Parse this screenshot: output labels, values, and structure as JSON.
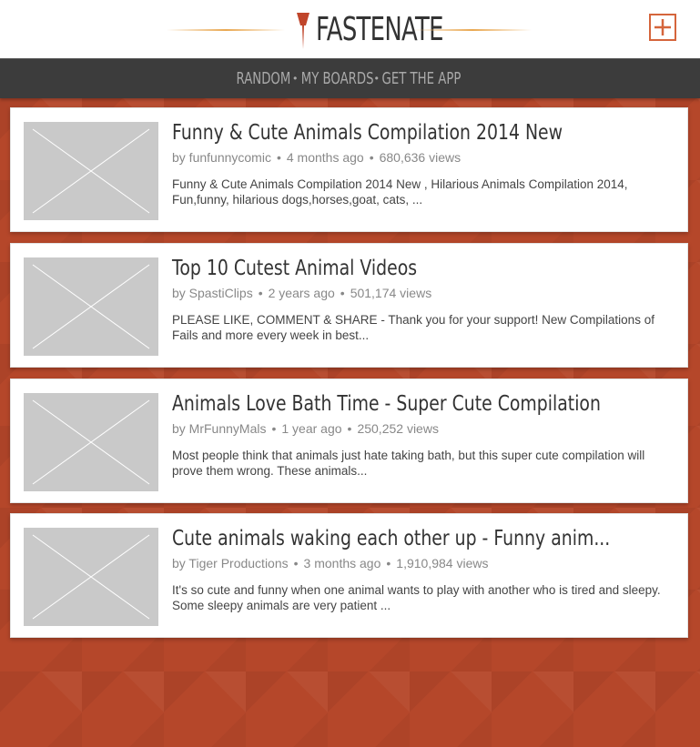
{
  "header": {
    "logo_text": "FASTENATE",
    "accent_color": "#d5653c",
    "line_color": "#e9a852"
  },
  "nav": {
    "items": [
      {
        "label": "RANDOM"
      },
      {
        "label": "MY BOARDS"
      },
      {
        "label": "GET THE APP"
      }
    ],
    "separator": "•"
  },
  "videos": [
    {
      "title": "Funny & Cute Animals Compilation 2014 New",
      "author": "by funfunnycomic",
      "age": "4 months ago",
      "views": "680,636 views",
      "description": "Funny & Cute Animals Compilation 2014 New , Hilarious Animals Compilation 2014, Fun,funny, hilarious dogs,horses,goat, cats, ..."
    },
    {
      "title": "Top 10 Cutest Animal Videos",
      "author": "by SpastiClips",
      "age": "2 years ago",
      "views": "501,174 views",
      "description": "PLEASE LIKE, COMMENT & SHARE - Thank you for your support! New Compilations of Fails and more every week in best..."
    },
    {
      "title": "Animals Love Bath Time - Super Cute Compilation",
      "author": "by MrFunnyMals",
      "age": "1 year ago",
      "views": "250,252 views",
      "description": "Most people think that animals just hate taking bath, but this super cute compilation will prove them wrong. These animals..."
    },
    {
      "title": "Cute animals waking each other up - Funny anim...",
      "author": "by Tiger Productions",
      "age": "3 months ago",
      "views": "1,910,984 views",
      "description": "It's so cute and funny when one animal wants to play with another who is tired and sleepy. Some sleepy animals are very patient ..."
    }
  ],
  "icons": {
    "logo": "push-pin-icon",
    "add": "plus-icon",
    "thumbnail": "image-placeholder-icon"
  },
  "colors": {
    "background": "#b5472a",
    "navbar": "#3c3c3c",
    "nav_text": "#a9a9a9"
  }
}
